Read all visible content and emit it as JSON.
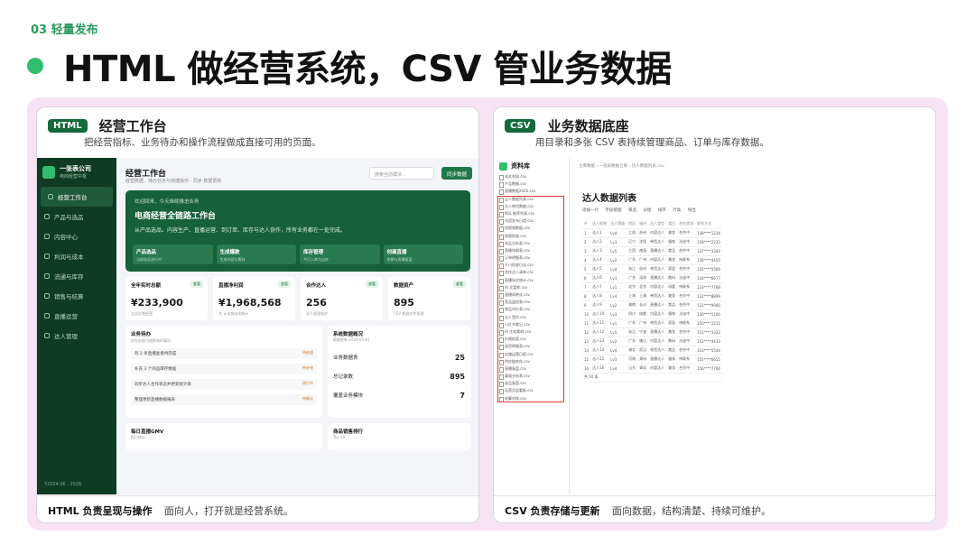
{
  "kicker": "03 轻量发布",
  "main_title": "HTML 做经营系统，CSV 管业务数据",
  "left_card": {
    "badge": "HTML",
    "title": "经营工作台",
    "subtitle": "把经营指标、业务待办和操作流程做成直接可用的页面。",
    "footer_bold": "HTML 负责呈现与操作",
    "footer_text": "面向人，打开就是经营系统。",
    "sidebar": {
      "company": "一张表公司",
      "company_sub": "电商经营中枢",
      "items": [
        "经营工作台",
        "产品与选品",
        "内容中心",
        "利润与成本",
        "流通与库存",
        "销售与结算",
        "直播运营",
        "达人管理"
      ],
      "footer": "Y2024.06 · 2026"
    },
    "header_title": "经营工作台",
    "header_sub": "经营数据、待办任务与快捷操作 · 同步 数据更新",
    "search_placeholder": "搜索当前模块…",
    "sync_button": "同步数据",
    "hero": {
      "eyebrow": "欢迎回来，今天继续推进业务",
      "title": "电商经营全链路工作台",
      "desc": "从产品选品、内容生产、直播运营、到订单、库存与达人协作，所有业务都在一处完成。",
      "tiles": [
        {
          "label": "产品选品",
          "note": "当前选品进行中"
        },
        {
          "label": "生成爆款",
          "note": "生成内容与素材"
        },
        {
          "label": "库存管理",
          "note": "今日入库与出库"
        },
        {
          "label": "创建直播",
          "note": "排期与直播复盘"
        }
      ]
    },
    "kpis": [
      {
        "label": "全年实时总额",
        "tag": "查看",
        "value": "¥233,900",
        "note": "全店近期经营"
      },
      {
        "label": "直播净利润",
        "tag": "查看",
        "value": "¥1,968,568",
        "note": "共 计本期成本统计"
      },
      {
        "label": "合作达人",
        "tag": "查看",
        "value": "256",
        "note": "达人管理维护"
      },
      {
        "label": "数据资产",
        "tag": "查看",
        "value": "895",
        "note": "CSV 数据文件管理"
      }
    ],
    "todo": {
      "title": "业务待办",
      "sub": "优先处理可能影响的事项",
      "rows": [
        {
          "text": "有 2 条直播复盘待完成",
          "tag": "待处理"
        },
        {
          "text": "补充 3 个商品库存数据",
          "tag": "待补充"
        },
        {
          "text": "同步达人合作状态并更新统计表",
          "tag": "进行中"
        },
        {
          "text": "整理更新直播数据报表",
          "tag": "待确认"
        }
      ]
    },
    "system": {
      "title": "系统数据概况",
      "sub": "数据更新 2026-05-01",
      "rows": [
        {
          "label": "业务数据表",
          "value": "25"
        },
        {
          "label": "总记录数",
          "value": "895"
        },
        {
          "label": "覆盖业务模块",
          "value": "7"
        }
      ]
    },
    "gmv_title": "每日直播GMV",
    "gmv_sub": "按日统计",
    "product_title": "商品销售排行",
    "product_sub": "Top 10"
  },
  "right_card": {
    "badge": "CSV",
    "title": "业务数据底座",
    "subtitle": "用目录和多张 CSV 表持续管理商品、订单与库存数据。",
    "footer_bold": "CSV 负责存储与更新",
    "footer_text": "面向数据，结构清楚、持续可维护。",
    "explorer_title": "资料库",
    "files": [
      "成本利润.csv",
      "产品数据.csv",
      "直播数据2025.csv",
      "达人数据列表.csv",
      "达人带货数据.csv",
      "KOL 推荐列表.csv",
      "内容发布日程.csv",
      "短视频数据.csv",
      "视频投放.csv",
      "选品分析表.csv",
      "直播排期表.csv",
      "订单明细表.csv",
      "千川投放日志.csv",
      "合作达人清单.csv",
      "直播场次统计.csv",
      "AI 文案库.csv",
      "直播间转化.csv",
      "竞品监控表.csv",
      "商品评价表.csv",
      "达人签约.csv",
      "小红书笔记.csv",
      "AI 生成素材.csv",
      "价格档案.csv",
      "退货明细表.csv",
      "店铺运营日报.csv",
      "供应链库存.csv",
      "直播复盘.csv",
      "渠道分析表.csv",
      "选品复盘.csv",
      "运营总监看板.csv",
      "结算对账.csv"
    ],
    "breadcrumb": "仓库数据 › 一张表数据仓库 › 达人数据列表.csv",
    "table_title": "达人数据列表",
    "toolbar": "添加一行 字段管理 筛选 分组 排序 行高 导出",
    "columns": [
      "#",
      "达人昵称",
      "达人等级",
      "地区",
      "城市",
      "达人类型",
      "类目",
      "合作状态",
      "联系方式"
    ],
    "rows": [
      [
        "1",
        "达人1",
        "Lv4",
        "江苏",
        "苏州",
        "内容达人",
        "美妆",
        "合作中",
        "138****1234"
      ],
      [
        "2",
        "达人2",
        "Lv3",
        "辽宁",
        "沈阳",
        "带货达人",
        "服饰",
        "洽谈中",
        "139****2233"
      ],
      [
        "3",
        "达人3",
        "Lv5",
        "江西",
        "南昌",
        "直播达人",
        "食品",
        "合作中",
        "137****3344"
      ],
      [
        "4",
        "达人4",
        "Lv2",
        "广东",
        "广州",
        "内容达人",
        "美妆",
        "待联系",
        "136****4455"
      ],
      [
        "5",
        "达人5",
        "Lv4",
        "浙江",
        "杭州",
        "带货达人",
        "家居",
        "合作中",
        "135****5566"
      ],
      [
        "6",
        "达人6",
        "Lv3",
        "广东",
        "深圳",
        "直播达人",
        "数码",
        "洽谈中",
        "134****6677"
      ],
      [
        "7",
        "达人7",
        "Lv1",
        "北京",
        "北京",
        "内容达人",
        "母婴",
        "待联系",
        "133****7788"
      ],
      [
        "8",
        "达人8",
        "Lv4",
        "上海",
        "上海",
        "带货达人",
        "美妆",
        "合作中",
        "132****8899"
      ],
      [
        "9",
        "达人9",
        "Lv2",
        "湖南",
        "长沙",
        "直播达人",
        "食品",
        "合作中",
        "131****9900"
      ],
      [
        "10",
        "达人10",
        "Lv3",
        "四川",
        "成都",
        "内容达人",
        "服饰",
        "洽谈中",
        "130****1100"
      ],
      [
        "11",
        "达人11",
        "Lv1",
        "广东",
        "广州",
        "带货达人",
        "家居",
        "待联系",
        "150****2211"
      ],
      [
        "12",
        "达人12",
        "Lv5",
        "浙江",
        "宁波",
        "直播达人",
        "美妆",
        "合作中",
        "151****3322"
      ],
      [
        "13",
        "达人13",
        "Lv2",
        "广东",
        "佛山",
        "内容达人",
        "数码",
        "洽谈中",
        "152****4433"
      ],
      [
        "14",
        "达人14",
        "Lv4",
        "湖北",
        "武汉",
        "带货达人",
        "食品",
        "合作中",
        "153****5544"
      ],
      [
        "15",
        "达人15",
        "Lv3",
        "河南",
        "郑州",
        "直播达人",
        "服饰",
        "待联系",
        "155****6655"
      ],
      [
        "16",
        "达人16",
        "Lv4",
        "山东",
        "青岛",
        "内容达人",
        "美妆",
        "合作中",
        "156****7766"
      ]
    ],
    "row_count": "共 16 条"
  }
}
